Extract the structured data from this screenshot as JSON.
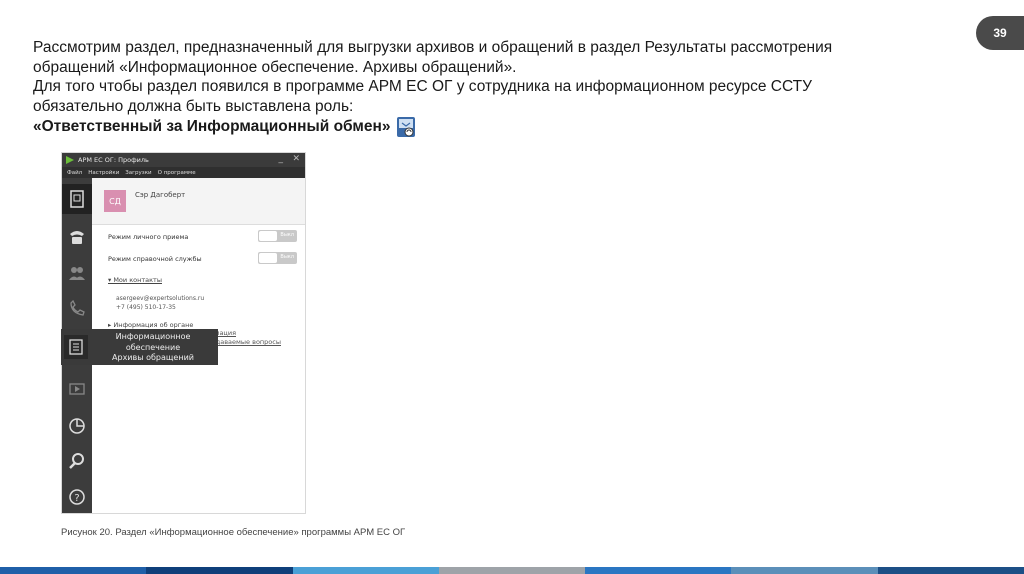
{
  "page_number": "39",
  "body": {
    "line1": "Рассмотрим раздел, предназначенный для выгрузки архивов и обращений в раздел Результаты рассмотрения",
    "line2": "обращений «Информационное обеспечение. Архивы обращений».",
    "line3": "Для того чтобы раздел появился в программе АРМ ЕС ОГ у сотрудника на информационном ресурсе ССТУ",
    "line4": "обязательно должна быть выставлена роль:",
    "role": "«Ответственный за Информационный обмен»"
  },
  "app": {
    "title": "АРМ ЕС ОГ: Профиль",
    "menu": [
      "Файл",
      "Настройки",
      "Загрузки",
      "О программе"
    ],
    "avatar_initials": "СД",
    "user_name": "Сэр Дагоберт",
    "mode_personal": "Режим личного приема",
    "mode_help": "Режим справочной службы",
    "toggle_label": "Выкл",
    "my_contacts": "▾ Мои контакты",
    "email": "asergeev@expertsolutions.ru",
    "phone": "+7 (495) 510-17-35",
    "org_info": "▸ Информация об органе",
    "link_partial_1": "Справочная информация",
    "link_partial_2": "Часто задаваемые вопросы",
    "tooltip_line1": "Информационное",
    "tooltip_line2": "обеспечение",
    "tooltip_line3": "Архивы обращений"
  },
  "caption": "Рисунок 20. Раздел «Информационное обеспечение» программы АРМ ЕС ОГ",
  "colors": {
    "footer": [
      "#1f5fa8",
      "#0f3f7a",
      "#4aa0d6",
      "#9ea3a8",
      "#2a76c2",
      "#5b8fb9",
      "#1c4f86"
    ]
  }
}
